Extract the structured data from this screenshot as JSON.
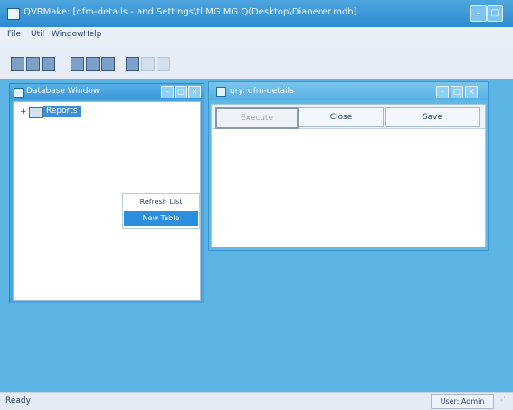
{
  "app": {
    "title": "QVRMake: [dfm-details - and Settings\\tl MG MG Q(Desktop\\Dianerer.mdb]"
  },
  "menu": [
    "File",
    "Util",
    "Window",
    "Help"
  ],
  "toolbar_icons": [
    "new-icon",
    "open-icon",
    "save-icon",
    "table-icon",
    "query-icon",
    "form-icon",
    "report-icon",
    "cut-icon",
    "copy-icon"
  ],
  "database_window": {
    "title": "Database Window",
    "tree": {
      "expander": "+",
      "root_label": "Reports"
    },
    "context_menu": {
      "items": [
        "Refresh List",
        "New Table"
      ],
      "selected_index": 1
    }
  },
  "query_window": {
    "title": "qry: dfm-details",
    "tabs": [
      "Execute",
      "Close",
      "Save"
    ],
    "active_tab_index": 0
  },
  "status": {
    "left": "Ready",
    "right": "User: Admin"
  }
}
